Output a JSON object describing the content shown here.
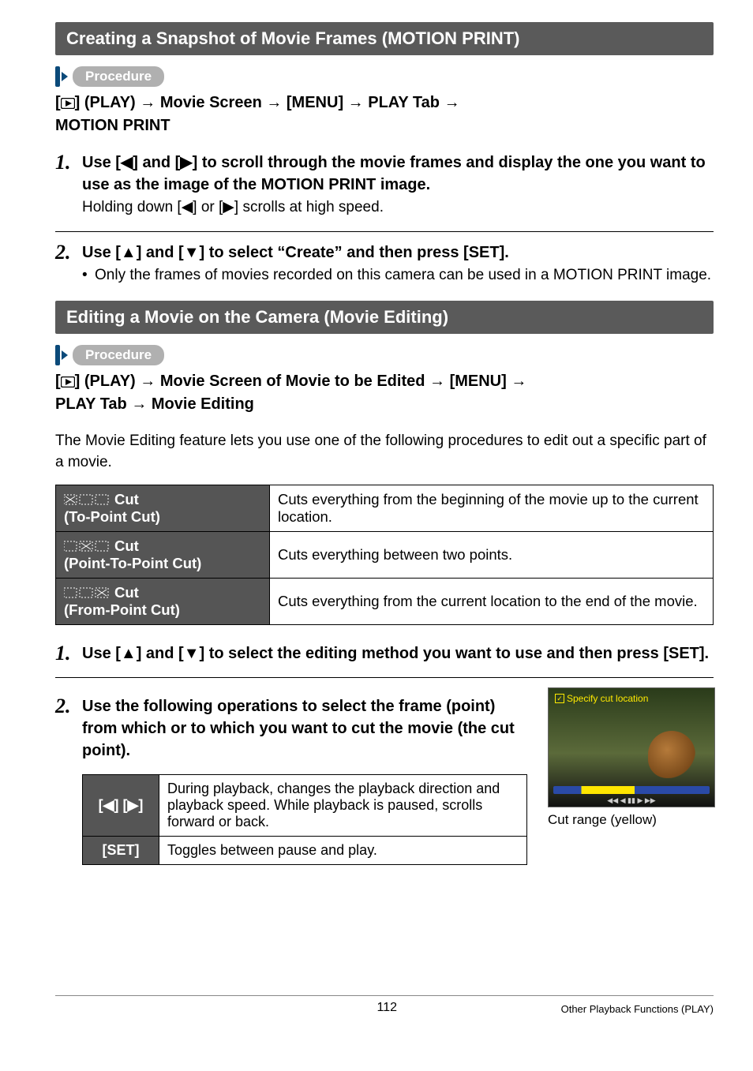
{
  "sections": {
    "motion_print": {
      "title": "Creating a Snapshot of Movie Frames (MOTION PRINT)",
      "procedure_label": "Procedure",
      "crumb_parts": [
        "[",
        "] (PLAY) ",
        " Movie Screen ",
        " [MENU] ",
        " PLAY Tab ",
        " MOTION PRINT"
      ],
      "steps": [
        {
          "num": "1.",
          "title": "Use [◀] and [▶] to scroll through the movie frames and display the one you want to use as the image of the MOTION PRINT image.",
          "body": "Holding down [◀] or [▶] scrolls at high speed."
        },
        {
          "num": "2.",
          "title": "Use [▲] and [▼] to select “Create” and then press [SET].",
          "bullet": "Only the frames of movies recorded on this camera can be used in a MOTION PRINT image."
        }
      ]
    },
    "movie_editing": {
      "title": "Editing a Movie on the Camera (Movie Editing)",
      "procedure_label": "Procedure",
      "crumb_parts": [
        "[",
        "] (PLAY) ",
        " Movie Screen of Movie to be Edited ",
        " [MENU] ",
        " PLAY Tab ",
        " Movie Editing"
      ],
      "intro": "The Movie Editing feature lets you use one of the following procedures to edit out a specific part of a movie.",
      "cut_table": [
        {
          "label_main": "Cut",
          "label_sub": "(To-Point Cut)",
          "desc": "Cuts everything from the beginning of the movie up to the current location."
        },
        {
          "label_main": "Cut",
          "label_sub": "(Point-To-Point Cut)",
          "desc": "Cuts everything between two points."
        },
        {
          "label_main": "Cut",
          "label_sub": "(From-Point Cut)",
          "desc": "Cuts everything from the current location to the end of the movie."
        }
      ],
      "steps": [
        {
          "num": "1.",
          "title": "Use [▲] and [▼] to select the editing method you want to use and then press [SET]."
        },
        {
          "num": "2.",
          "title": "Use the following operations to select the frame (point) from which or to which you want to cut the movie (the cut point).",
          "ops": [
            {
              "keys": "[◀] [▶]",
              "desc": "During playback, changes the playback direction and playback speed. While playback is paused, scrolls forward or back."
            },
            {
              "keys": "[SET]",
              "desc": "Toggles between pause and play."
            }
          ],
          "screenshot_label": "Specify cut location",
          "caption": "Cut range (yellow)"
        }
      ]
    }
  },
  "footer": {
    "page": "112",
    "ref": "Other Playback Functions (PLAY)"
  }
}
